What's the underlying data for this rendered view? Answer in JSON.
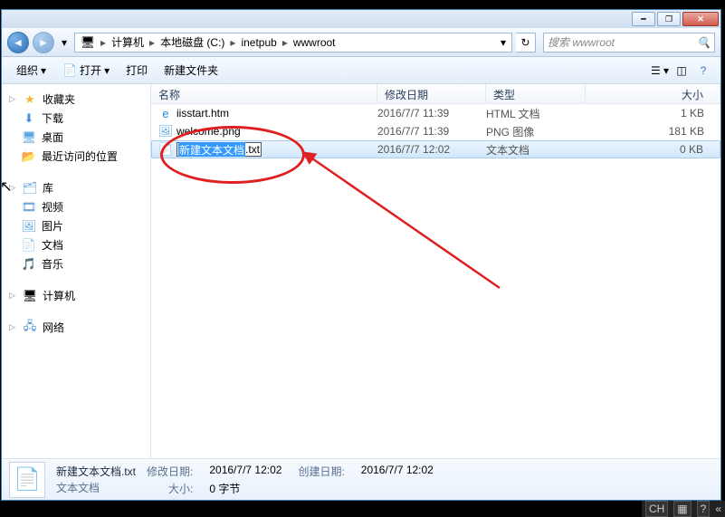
{
  "breadcrumb": {
    "root_icon": "computer",
    "segments": [
      "计算机",
      "本地磁盘 (C:)",
      "inetpub",
      "wwwroot"
    ]
  },
  "search": {
    "placeholder": "搜索 wwwroot"
  },
  "toolbar": {
    "org": "组织",
    "open": "打开",
    "print": "打印",
    "newfolder": "新建文件夹"
  },
  "columns": {
    "name": "名称",
    "date": "修改日期",
    "type": "类型",
    "size": "大小"
  },
  "sidebar": {
    "fav": {
      "head": "收藏夹",
      "items": [
        "下载",
        "桌面",
        "最近访问的位置"
      ]
    },
    "lib": {
      "head": "库",
      "items": [
        "视频",
        "图片",
        "文档",
        "音乐"
      ]
    },
    "comp": "计算机",
    "net": "网络"
  },
  "files": [
    {
      "name": "iisstart.htm",
      "date": "2016/7/7 11:39",
      "type": "HTML 文档",
      "size": "1 KB",
      "icon": "html"
    },
    {
      "name": "welcome.png",
      "date": "2016/7/7 11:39",
      "type": "PNG 图像",
      "size": "181 KB",
      "icon": "png"
    },
    {
      "name_sel": "新建文本文档",
      "name_ext": ".txt",
      "date": "2016/7/7 12:02",
      "type": "文本文档",
      "size": "0 KB",
      "icon": "txt",
      "renaming": true
    }
  ],
  "details": {
    "filename": "新建文本文档.txt",
    "filetype": "文本文档",
    "mod_label": "修改日期:",
    "mod_value": "2016/7/7 12:02",
    "size_label": "大小:",
    "size_value": "0 字节",
    "create_label": "创建日期:",
    "create_value": "2016/7/7 12:02"
  },
  "tray": {
    "ch": "CH",
    "ime": "▦",
    "help": "?"
  }
}
